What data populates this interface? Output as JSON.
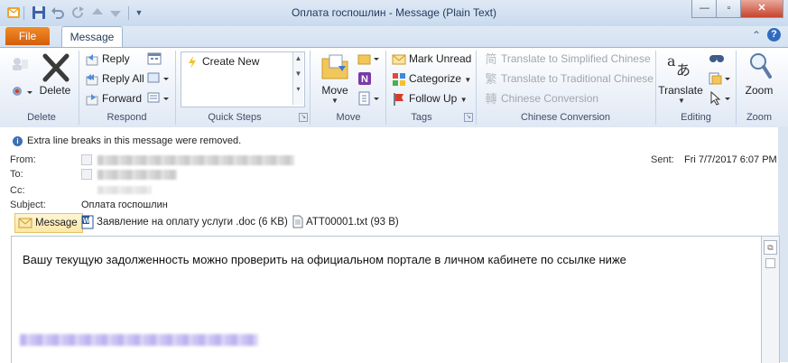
{
  "window": {
    "title": "Оплата госпошлин  -  Message (Plain Text)"
  },
  "tabs": {
    "file": "File",
    "message": "Message"
  },
  "ribbon": {
    "delete_group": {
      "delete_label": "Delete",
      "group_label": "Delete"
    },
    "respond_group": {
      "reply": "Reply",
      "reply_all": "Reply All",
      "forward": "Forward",
      "group_label": "Respond"
    },
    "quick_steps": {
      "create_new": "Create New",
      "group_label": "Quick Steps"
    },
    "move_group": {
      "move_label": "Move",
      "group_label": "Move"
    },
    "tags_group": {
      "mark_unread": "Mark Unread",
      "categorize": "Categorize",
      "follow_up": "Follow Up",
      "group_label": "Tags"
    },
    "chinese_group": {
      "simplified": "Translate to Simplified Chinese",
      "traditional": "Translate to Traditional Chinese",
      "conversion": "Chinese Conversion",
      "group_label": "Chinese Conversion"
    },
    "editing_group": {
      "translate": "Translate",
      "group_label": "Editing"
    },
    "zoom_group": {
      "zoom": "Zoom",
      "group_label": "Zoom"
    }
  },
  "infobar": {
    "text": "Extra line breaks in this message were removed."
  },
  "header": {
    "from_label": "From:",
    "to_label": "To:",
    "cc_label": "Cc:",
    "subject_label": "Subject:",
    "subject": "Оплата госпошлин",
    "sent_label": "Sent:",
    "sent_value": "Fri 7/7/2017 6:07 PM"
  },
  "attachments": [
    {
      "label": "Message",
      "icon": "envelope-icon"
    },
    {
      "label": "Заявление на оплату услуги .doc (6 KB)",
      "icon": "word-doc-icon"
    },
    {
      "label": "ATT00001.txt (93 B)",
      "icon": "text-file-icon"
    }
  ],
  "body": {
    "text": "Вашу текущую задолженность можно проверить  на официальном портале  в личном кабинете по ссылке ниже"
  },
  "colors": {
    "file_tab": "#e3741b",
    "ribbon_bg": "#e9eff8",
    "accent": "#1e395b"
  }
}
